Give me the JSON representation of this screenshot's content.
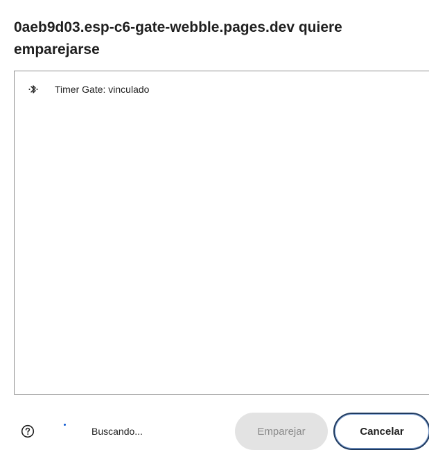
{
  "dialog": {
    "title": "0aeb9d03.esp-c6-gate-webble.pages.dev quiere emparejarse"
  },
  "device_list": {
    "items": [
      {
        "icon": "bluetooth-icon",
        "label": "Timer Gate: vinculado"
      }
    ]
  },
  "footer": {
    "help_icon": "help-circle-icon",
    "status_text": "Buscando...",
    "pair_label": "Emparejar",
    "cancel_label": "Cancelar"
  },
  "colors": {
    "accent": "#0b57d0",
    "disabled_button_bg": "#e3e3e3",
    "disabled_button_text": "#8a8a8a"
  }
}
